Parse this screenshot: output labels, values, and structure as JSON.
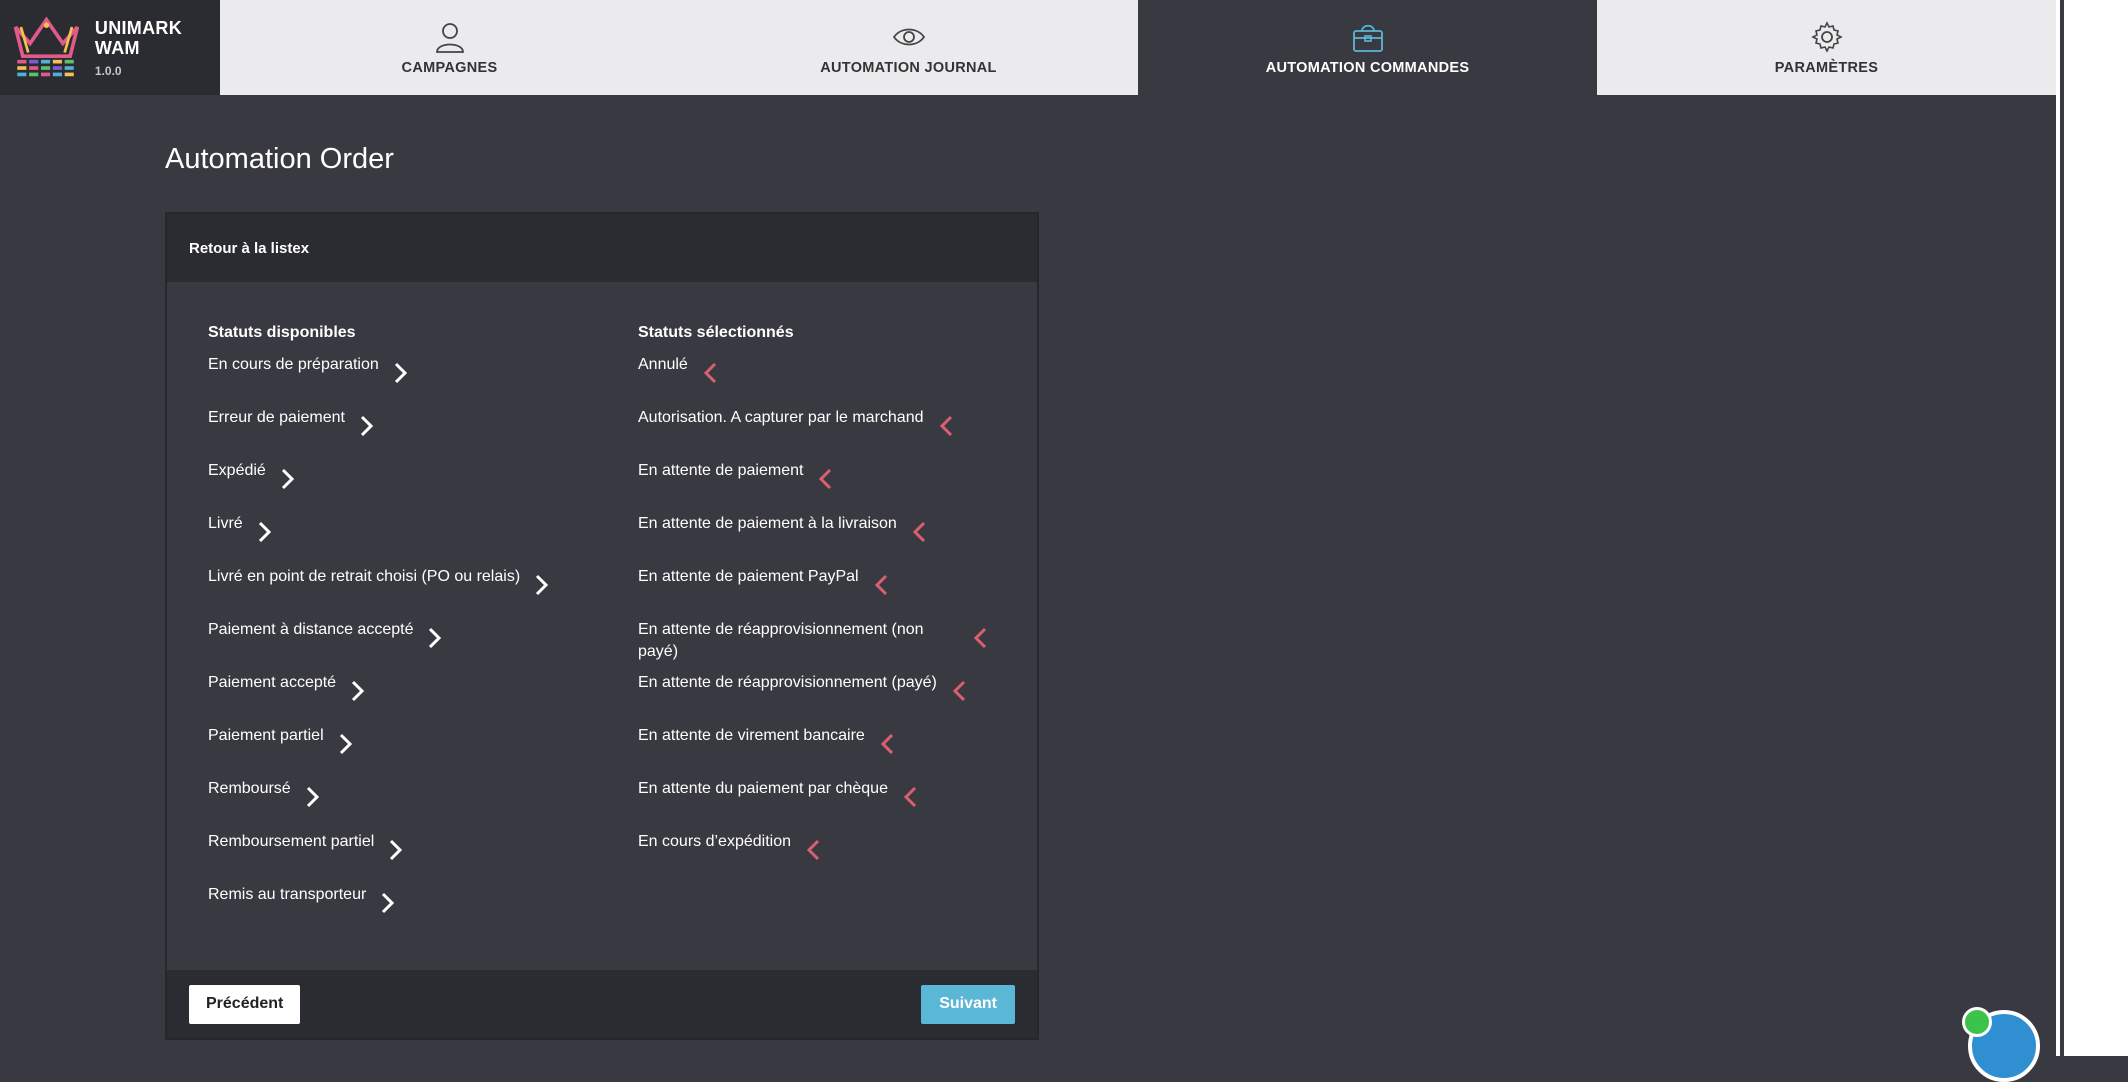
{
  "app": {
    "name": "UNIMARK WAM",
    "version": "1.0.0"
  },
  "tabs": [
    {
      "label": "CAMPAGNES",
      "icon": "user-icon"
    },
    {
      "label": "AUTOMATION JOURNAL",
      "icon": "eye-icon"
    },
    {
      "label": "AUTOMATION COMMANDES",
      "icon": "basket-icon",
      "active": true
    },
    {
      "label": "PARAMÈTRES",
      "icon": "gear-icon"
    }
  ],
  "page": {
    "title": "Automation Order"
  },
  "panel": {
    "back_link": "Retour à la listex",
    "available_title": "Statuts disponibles",
    "selected_title": "Statuts sélectionnés",
    "available": [
      "En cours de préparation",
      "Erreur de paiement",
      "Expédié",
      "Livré",
      "Livré en point de retrait choisi (PO ou relais)",
      "Paiement à distance accepté",
      "Paiement accepté",
      "Paiement partiel",
      "Remboursé",
      "Remboursement partiel",
      "Remis au transporteur"
    ],
    "selected": [
      "Annulé",
      "Autorisation. A capturer par le marchand",
      "En attente de paiement",
      "En attente de paiement à la livraison",
      "En attente de paiement PayPal",
      "En attente de réapprovisionnement (non payé)",
      "En attente de réapprovisionnement (payé)",
      "En attente de virement bancaire",
      "En attente du paiement par chèque",
      "En cours d’expédition"
    ],
    "prev_label": "Précédent",
    "next_label": "Suivant"
  },
  "colors": {
    "background": "#393a41",
    "header": "#2b2c31",
    "tab_inactive": "#ebebee",
    "add_arrow": "#ffffff",
    "remove_arrow": "#d9606e",
    "next_button": "#5bb7d6"
  }
}
